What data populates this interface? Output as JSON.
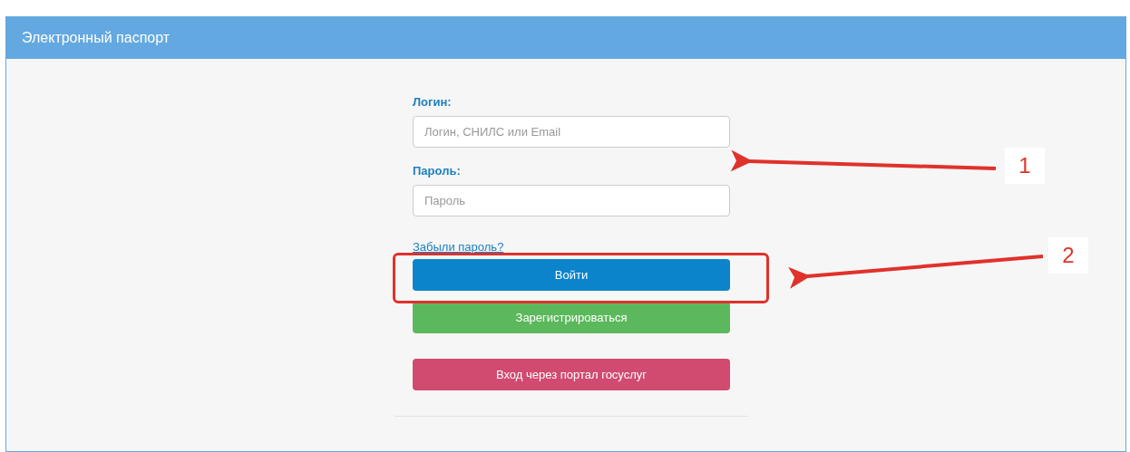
{
  "header": {
    "title": "Электронный паспорт"
  },
  "fields": [
    {
      "label": "Логин:",
      "placeholder": "Логин, СНИЛС или Email"
    },
    {
      "label": "Пароль:",
      "placeholder": "Пароль"
    }
  ],
  "forgot_link": "Забыли пароль?",
  "buttons": [
    {
      "label": "Войти",
      "kind": "primary"
    },
    {
      "label": "Зарегистрироваться",
      "kind": "success"
    },
    {
      "label": "Вход через портал госуслуг",
      "kind": "gosuslugi"
    }
  ],
  "annotations": [
    {
      "number": "1"
    },
    {
      "number": "2"
    }
  ]
}
